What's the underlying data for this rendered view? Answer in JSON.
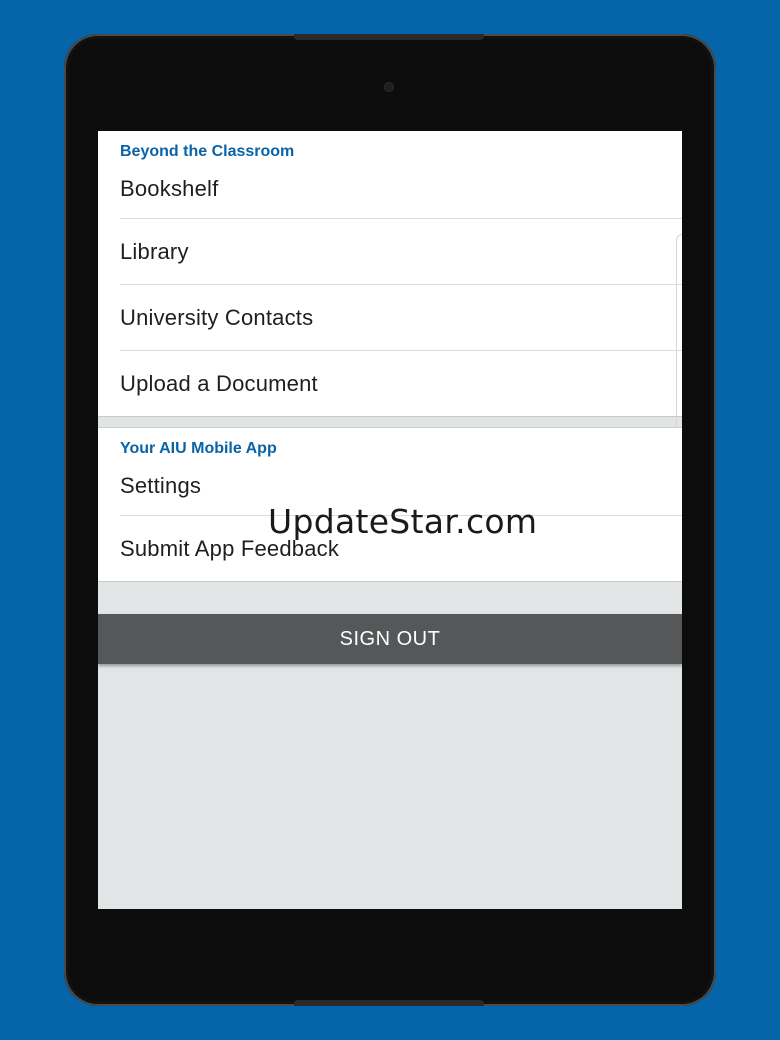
{
  "sections": [
    {
      "header": "Beyond the Classroom",
      "items": [
        "Bookshelf",
        "Library",
        "University Contacts",
        "Upload a Document"
      ]
    },
    {
      "header": "Your AIU Mobile App",
      "items": [
        "Settings",
        "Submit App Feedback"
      ]
    }
  ],
  "sign_out_label": "SIGN OUT",
  "watermark": "UpdateStar.com",
  "colors": {
    "background": "#0565a8",
    "section_header": "#0a63a6",
    "sign_out_button": "#565759"
  }
}
